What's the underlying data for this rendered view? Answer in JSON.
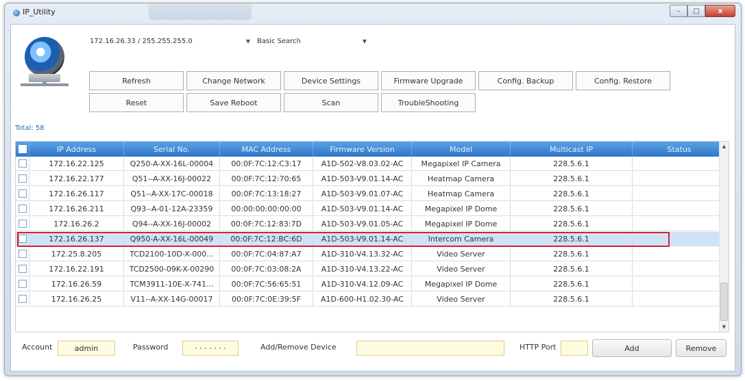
{
  "window": {
    "title": "IP_Utility"
  },
  "window_buttons": {
    "minimize": "–",
    "maximize": "□",
    "close": "x"
  },
  "toolbar": {
    "ip_combo_value": "172.16.26.33 / 255.255.255.0",
    "search_mode": "Basic Search",
    "buttons_row1": [
      "Refresh",
      "Change Network",
      "Device Settings",
      "Firmware Upgrade",
      "Config. Backup",
      "Config. Restore"
    ],
    "buttons_row2": [
      "Reset",
      "Save Reboot",
      "Scan",
      "TroubleShooting"
    ]
  },
  "total_label": "Total: 58",
  "table": {
    "columns": [
      "IP Address",
      "Serial No.",
      "MAC Address",
      "Firmware Version",
      "Model",
      "Multicast IP",
      "Status"
    ],
    "rows": [
      {
        "ip": "172.16.22.125",
        "serial": "Q250-A-XX-16L-00004",
        "mac": "00:0F:7C:12:C3:17",
        "fw": "A1D-502-V8.03.02-AC",
        "model": "Megapixel IP Camera",
        "mcast": "228.5.6.1",
        "status": ""
      },
      {
        "ip": "172.16.22.177",
        "serial": "Q51--A-XX-16J-00022",
        "mac": "00:0F:7C:12:70:65",
        "fw": "A1D-503-V9.01.14-AC",
        "model": "Heatmap Camera",
        "mcast": "228.5.6.1",
        "status": ""
      },
      {
        "ip": "172.16.26.117",
        "serial": "Q51--A-XX-17C-00018",
        "mac": "00:0F:7C:13:18:27",
        "fw": "A1D-503-V9.01.07-AC",
        "model": "Heatmap Camera",
        "mcast": "228.5.6.1",
        "status": ""
      },
      {
        "ip": "172.16.26.211",
        "serial": "Q93--A-01-12A-23359",
        "mac": "00:00:00:00:00:00",
        "fw": "A1D-503-V9.01.14-AC",
        "model": "Megapixel IP Dome",
        "mcast": "228.5.6.1",
        "status": ""
      },
      {
        "ip": "172.16.26.2",
        "serial": "Q94--A-XX-16J-00002",
        "mac": "00:0F:7C:12:83:7D",
        "fw": "A1D-503-V9.01.05-AC",
        "model": "Megapixel IP Dome",
        "mcast": "228.5.6.1",
        "status": ""
      },
      {
        "ip": "172.16.26.137",
        "serial": "Q950-A-XX-16L-00049",
        "mac": "00:0F:7C:12:BC:6D",
        "fw": "A1D-503-V9.01.14-AC",
        "model": "Intercom Camera",
        "mcast": "228.5.6.1",
        "status": ""
      },
      {
        "ip": "172.25.8.205",
        "serial": "TCD2100-10D-X-000...",
        "mac": "00:0F:7C:04:87:A7",
        "fw": "A1D-310-V4.13.32-AC",
        "model": "Video Server",
        "mcast": "228.5.6.1",
        "status": ""
      },
      {
        "ip": "172.16.22.191",
        "serial": "TCD2500-09K-X-00290",
        "mac": "00:0F:7C:03:08:2A",
        "fw": "A1D-310-V4.13.22-AC",
        "model": "Video Server",
        "mcast": "228.5.6.1",
        "status": ""
      },
      {
        "ip": "172.16.26.59",
        "serial": "TCM3911-10E-X-741...",
        "mac": "00:0F:7C:56:65:51",
        "fw": "A1D-310-V4.12.09-AC",
        "model": "Megapixel IP Dome",
        "mcast": "228.5.6.1",
        "status": ""
      },
      {
        "ip": "172.16.26.25",
        "serial": "V11--A-XX-14G-00017",
        "mac": "00:0F:7C:0E:39:5F",
        "fw": "A1D-600-H1.02.30-AC",
        "model": "Video Server",
        "mcast": "228.5.6.1",
        "status": ""
      }
    ]
  },
  "bottom": {
    "account_label": "Account",
    "account_value": "admin",
    "password_label": "Password",
    "password_value": "· · · · · · ·",
    "add_remove_label": "Add/Remove Device",
    "add_remove_value": "",
    "http_port_label": "HTTP Port",
    "http_port_value": "",
    "add_button": "Add",
    "remove_button": "Remove"
  },
  "colors": {
    "header_blue": "#2f77c8",
    "selected_row": "#cfe3f7",
    "highlight_red": "#d8202a",
    "field_yellow": "#fffbe0"
  }
}
